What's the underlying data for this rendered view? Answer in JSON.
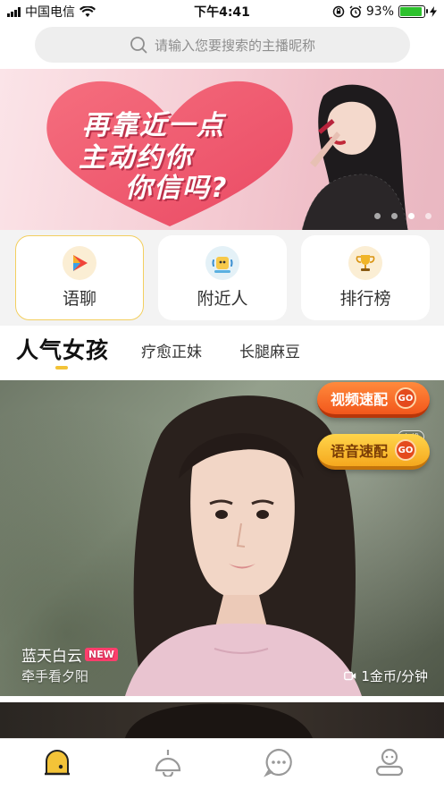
{
  "status_bar": {
    "carrier": "中国电信",
    "time": "下午4:41",
    "battery": "93%",
    "battery_level": 0.93
  },
  "search": {
    "placeholder": "请输入您要搜索的主播昵称"
  },
  "banner": {
    "line1": "再靠近一点",
    "line2": "主动约你",
    "line3": "你信吗?",
    "slides": 4,
    "active_slide": 2
  },
  "features": [
    {
      "label": "语聊",
      "icon": "play-icon",
      "active": true
    },
    {
      "label": "附近人",
      "icon": "nearby-icon",
      "active": false
    },
    {
      "label": "排行榜",
      "icon": "trophy-icon",
      "active": false
    }
  ],
  "tabs": [
    {
      "label": "人气女孩",
      "active": true
    },
    {
      "label": "疗愈正妹",
      "active": false
    },
    {
      "label": "长腿麻豆",
      "active": false
    }
  ],
  "feed": {
    "video_match_label": "视频速配",
    "voice_match_label": "语音速配",
    "go_label": "GO",
    "online_label": "在线",
    "host_name": "蓝天白云",
    "new_badge": "NEW",
    "host_sign": "牵手看夕阳",
    "price": "1金币/分钟"
  },
  "colors": {
    "accent": "#f3c338",
    "video_btn": "#f2571c",
    "voice_btn": "#f5a81e",
    "new_badge": "#ff3e6c"
  },
  "bottom_nav": [
    {
      "name": "home-tab",
      "icon": "home-arch-icon",
      "active": true
    },
    {
      "name": "live-tab",
      "icon": "lamp-icon",
      "active": false
    },
    {
      "name": "messages-tab",
      "icon": "chat-bubble-icon",
      "active": false
    },
    {
      "name": "profile-tab",
      "icon": "user-icon",
      "active": false
    }
  ]
}
